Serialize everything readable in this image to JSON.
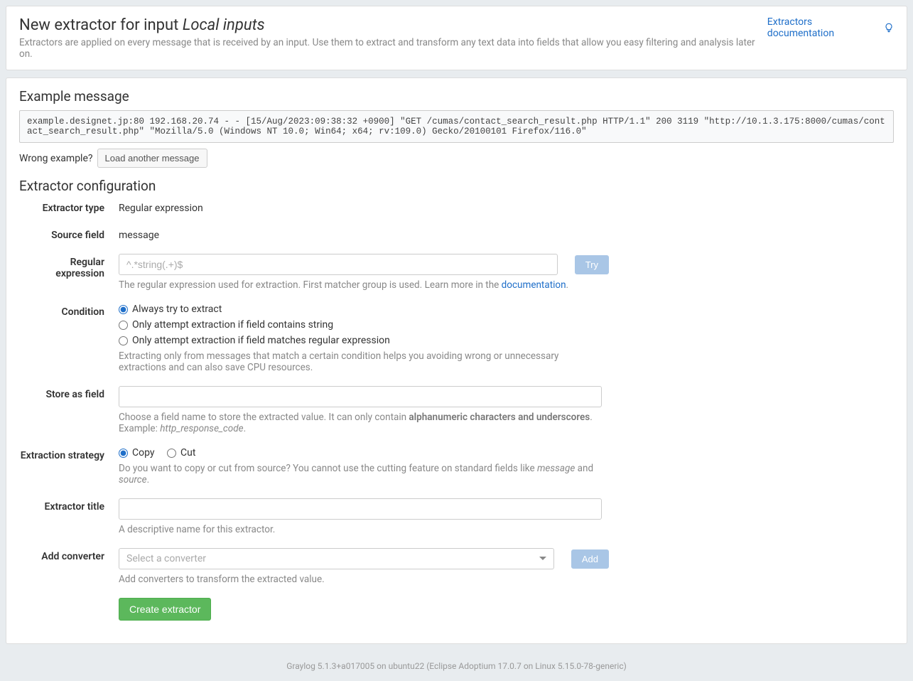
{
  "header": {
    "title_prefix": "New extractor for input ",
    "title_input": "Local inputs",
    "subtext": "Extractors are applied on every message that is received by an input. Use them to extract and transform any text data into fields that allow you easy filtering and analysis later on.",
    "doc_link": "Extractors documentation"
  },
  "example": {
    "heading": "Example message",
    "message": "example.designet.jp:80 192.168.20.74 - - [15/Aug/2023:09:38:32 +0900] \"GET /cumas/contact_search_result.php HTTP/1.1\" 200 3119 \"http://10.1.3.175:8000/cumas/contact_search_result.php\" \"Mozilla/5.0 (Windows NT 10.0; Win64; x64; rv:109.0) Gecko/20100101 Firefox/116.0\"",
    "wrong_label": "Wrong example?",
    "load_btn": "Load another message"
  },
  "config": {
    "heading": "Extractor configuration",
    "type_label": "Extractor type",
    "type_value": "Regular expression",
    "source_label": "Source field",
    "source_value": "message",
    "regex_label": "Regular expression",
    "regex_placeholder": "^.*string(.+)$",
    "try_btn": "Try",
    "regex_help_pre": "The regular expression used for extraction. First matcher group is used. Learn more in the ",
    "regex_help_link": "documentation",
    "condition_label": "Condition",
    "cond_opt1": "Always try to extract",
    "cond_opt2": "Only attempt extraction if field contains string",
    "cond_opt3": "Only attempt extraction if field matches regular expression",
    "cond_help": "Extracting only from messages that match a certain condition helps you avoiding wrong or unnecessary extractions and can also save CPU resources.",
    "store_label": "Store as field",
    "store_help_pre": "Choose a field name to store the extracted value. It can only contain ",
    "store_help_strong": "alphanumeric characters and underscores",
    "store_help_post": ". Example: ",
    "store_help_example": "http_response_code",
    "strategy_label": "Extraction strategy",
    "strategy_copy": "Copy",
    "strategy_cut": "Cut",
    "strategy_help_pre": "Do you want to copy or cut from source? You cannot use the cutting feature on standard fields like ",
    "strategy_help_em1": "message",
    "strategy_help_mid": " and ",
    "strategy_help_em2": "source",
    "title_label": "Extractor title",
    "title_help": "A descriptive name for this extractor.",
    "converter_label": "Add converter",
    "converter_placeholder": "Select a converter",
    "add_btn": "Add",
    "converter_help": "Add converters to transform the extracted value.",
    "create_btn": "Create extractor"
  },
  "footer": "Graylog 5.1.3+a017005 on ubuntu22 (Eclipse Adoptium 17.0.7 on Linux 5.15.0-78-generic)"
}
